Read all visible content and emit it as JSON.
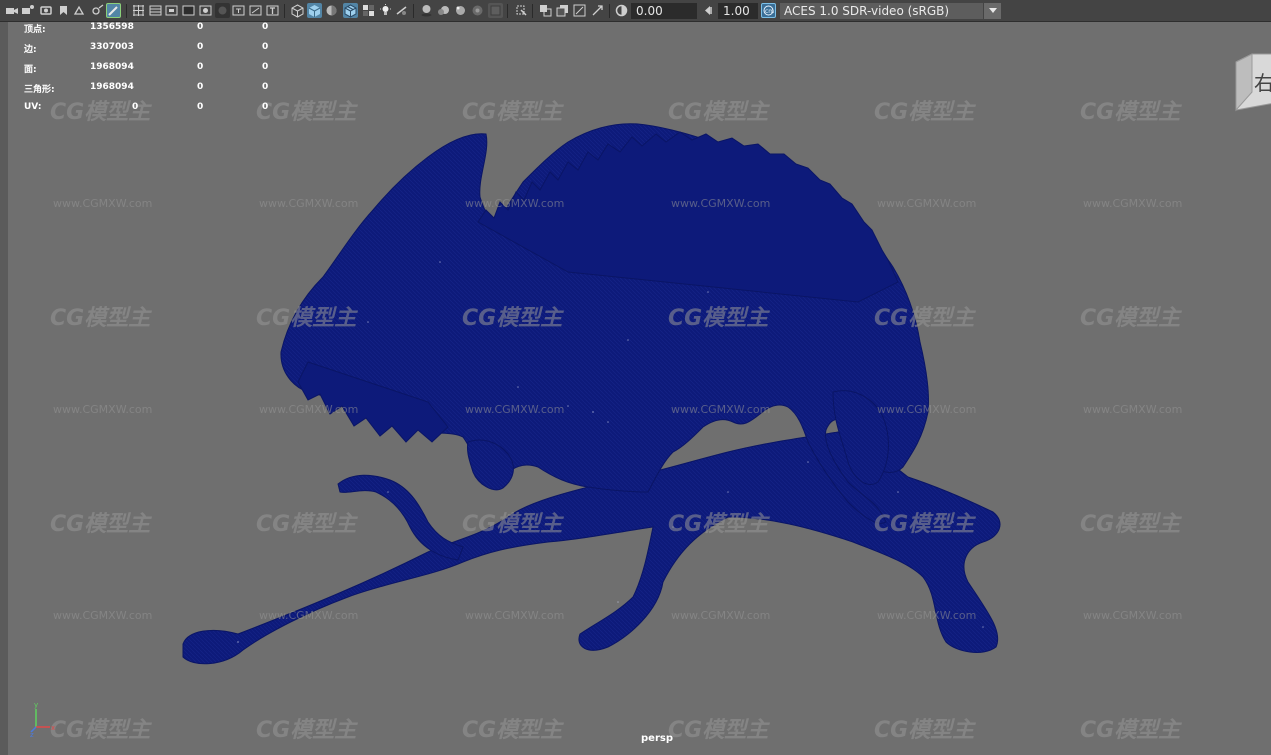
{
  "toolbar": {
    "exposure_value": "0.00",
    "gamma_value": "1.00",
    "color_management": "ACES 1.0 SDR-video (sRGB)",
    "icons": [
      "camera-icon",
      "camera-attributes-icon",
      "bookmark-icon",
      "image-plane-icon",
      "grid-toggle-icon",
      "film-gate-icon",
      "resolution-gate-icon",
      "field-chart-icon",
      "safe-action-icon",
      "safe-title-icon",
      "wireframe-icon",
      "smooth-shade-icon",
      "wireframe-on-shaded-icon",
      "textured-icon",
      "use-all-lights-icon",
      "shadows-icon",
      "ambient-occlusion-icon",
      "isolate-select-icon",
      "xray-icon",
      "exposure-icon",
      "gamma-icon",
      "view-transform-icon"
    ]
  },
  "hud": {
    "rows": [
      {
        "label": "顶点:",
        "v1": "1356598",
        "v2": "0",
        "v3": "0"
      },
      {
        "label": "边:",
        "v1": "3307003",
        "v2": "0",
        "v3": "0"
      },
      {
        "label": "面:",
        "v1": "1968094",
        "v2": "0",
        "v3": "0"
      },
      {
        "label": "三角形:",
        "v1": "1968094",
        "v2": "0",
        "v3": "0"
      },
      {
        "label": "UV:",
        "v1": "0",
        "v2": "0",
        "v3": "0"
      }
    ]
  },
  "viewport": {
    "camera": "persp",
    "viewcube_face": "右",
    "model_color": "#0d1a7a"
  },
  "watermark": {
    "logo": "CG模型主",
    "url": "www.CGMXW.com"
  }
}
